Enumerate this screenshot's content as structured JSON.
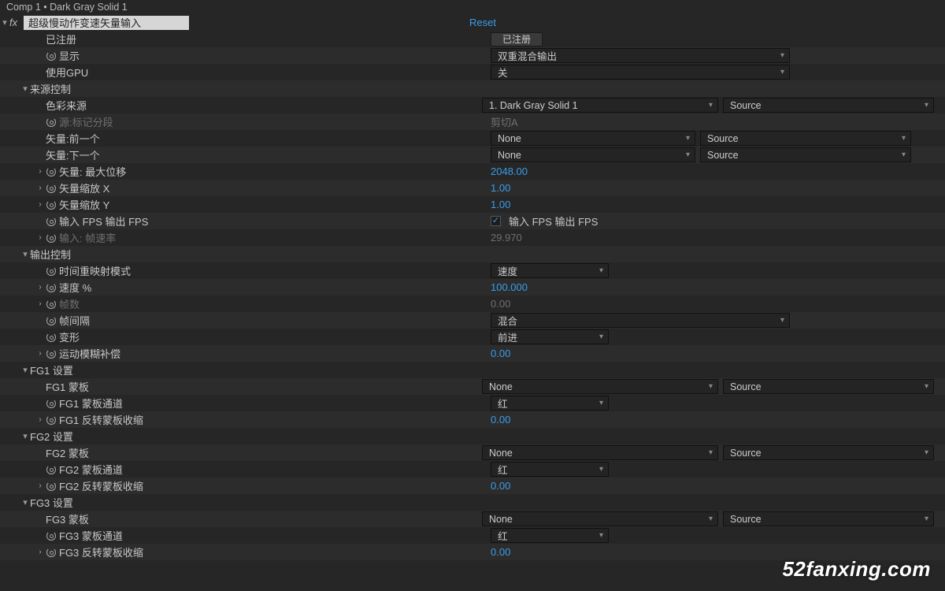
{
  "title_bar": "Comp 1 • Dark Gray Solid 1",
  "effect": {
    "name": "超级慢动作变速矢量输入",
    "reset": "Reset"
  },
  "btn_registered": "已注册",
  "rows": [
    {
      "indent": 2,
      "stopwatch": false,
      "label": "已注册",
      "kind": "button"
    },
    {
      "indent": 2,
      "stopwatch": true,
      "label": "显示",
      "kind": "dd1",
      "val": "双重混合输出",
      "w": "wA"
    },
    {
      "indent": 2,
      "stopwatch": false,
      "label": "使用GPU",
      "kind": "dd1",
      "val": "关",
      "w": "wA"
    },
    {
      "indent": 1,
      "twirl": "down",
      "label": "来源控制",
      "kind": "group"
    },
    {
      "indent": 2,
      "stopwatch": false,
      "label": "色彩来源",
      "kind": "dd2",
      "val": "1. Dark Gray Solid 1",
      "val2": "Source"
    },
    {
      "indent": 2,
      "stopwatch": true,
      "label": "源:标记分段",
      "kind": "textdim",
      "val": "剪切A",
      "dim": true
    },
    {
      "indent": 2,
      "stopwatch": false,
      "label": "矢量:前一个",
      "kind": "dd2",
      "val": "None",
      "val2": "Source",
      "wa": "wD",
      "wb": "wC"
    },
    {
      "indent": 2,
      "stopwatch": false,
      "label": "矢量:下一个",
      "kind": "dd2",
      "val": "None",
      "val2": "Source",
      "wa": "wD",
      "wb": "wC"
    },
    {
      "indent": 2,
      "arrow": true,
      "stopwatch": true,
      "label": "矢量: 最大位移",
      "kind": "num",
      "val": "2048.00"
    },
    {
      "indent": 2,
      "arrow": true,
      "stopwatch": true,
      "label": "矢量缩放 X",
      "kind": "num",
      "val": "1.00"
    },
    {
      "indent": 2,
      "arrow": true,
      "stopwatch": true,
      "label": "矢量缩放 Y",
      "kind": "num",
      "val": "1.00"
    },
    {
      "indent": 2,
      "stopwatch": true,
      "label": "输入 FPS 输出 FPS",
      "kind": "check",
      "val": "输入 FPS 输出 FPS"
    },
    {
      "indent": 2,
      "arrow": true,
      "stopwatch": true,
      "label": "输入: 帧速率",
      "kind": "numdim",
      "val": "29.970",
      "dim": true
    },
    {
      "indent": 1,
      "twirl": "down",
      "label": "输出控制",
      "kind": "group"
    },
    {
      "indent": 2,
      "stopwatch": true,
      "label": "时间重映射模式",
      "kind": "dd1",
      "val": "速度",
      "w": "wE"
    },
    {
      "indent": 2,
      "arrow": true,
      "stopwatch": true,
      "label": "速度 %",
      "kind": "num",
      "val": "100.000"
    },
    {
      "indent": 2,
      "arrow": true,
      "stopwatch": true,
      "label": "帧数",
      "kind": "numdim",
      "val": "0.00",
      "dim": true
    },
    {
      "indent": 2,
      "stopwatch": true,
      "label": "帧间隔",
      "kind": "dd1",
      "val": "混合",
      "w": "wA"
    },
    {
      "indent": 2,
      "stopwatch": true,
      "label": "变形",
      "kind": "dd1",
      "val": "前进",
      "w": "wE"
    },
    {
      "indent": 2,
      "arrow": true,
      "stopwatch": true,
      "label": "运动模糊补偿",
      "kind": "num",
      "val": "0.00"
    },
    {
      "indent": 1,
      "twirl": "down",
      "label": "FG1 设置",
      "kind": "group"
    },
    {
      "indent": 2,
      "stopwatch": false,
      "label": "FG1 蒙板",
      "kind": "dd2",
      "val": "None",
      "val2": "Source"
    },
    {
      "indent": 2,
      "stopwatch": true,
      "label": "FG1 蒙板通道",
      "kind": "dd1",
      "val": "红",
      "w": "wE"
    },
    {
      "indent": 2,
      "arrow": true,
      "stopwatch": true,
      "label": "FG1 反转蒙板收缩",
      "kind": "num",
      "val": "0.00"
    },
    {
      "indent": 1,
      "twirl": "down",
      "label": "FG2 设置",
      "kind": "group"
    },
    {
      "indent": 2,
      "stopwatch": false,
      "label": "FG2 蒙板",
      "kind": "dd2",
      "val": "None",
      "val2": "Source"
    },
    {
      "indent": 2,
      "stopwatch": true,
      "label": "FG2 蒙板通道",
      "kind": "dd1",
      "val": "红",
      "w": "wE"
    },
    {
      "indent": 2,
      "arrow": true,
      "stopwatch": true,
      "label": "FG2 反转蒙板收缩",
      "kind": "num",
      "val": "0.00"
    },
    {
      "indent": 1,
      "twirl": "down",
      "label": "FG3 设置",
      "kind": "group"
    },
    {
      "indent": 2,
      "stopwatch": false,
      "label": "FG3 蒙板",
      "kind": "dd2",
      "val": "None",
      "val2": "Source"
    },
    {
      "indent": 2,
      "stopwatch": true,
      "label": "FG3 蒙板通道",
      "kind": "dd1",
      "val": "红",
      "w": "wE"
    },
    {
      "indent": 2,
      "arrow": true,
      "stopwatch": true,
      "label": "FG3 反转蒙板收缩",
      "kind": "num",
      "val": "0.00"
    }
  ],
  "watermark": "52fanxing.com"
}
